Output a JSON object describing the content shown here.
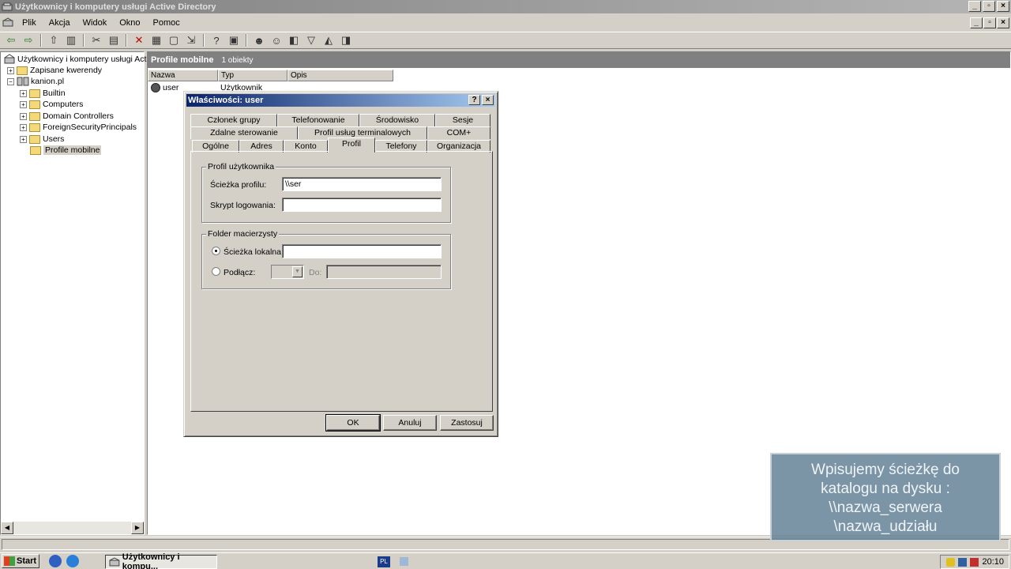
{
  "window": {
    "title": "Użytkownicy i komputery usługi Active Directory"
  },
  "menu": [
    "Plik",
    "Akcja",
    "Widok",
    "Okno",
    "Pomoc"
  ],
  "tree": {
    "root": "Użytkownicy i komputery usługi Activ",
    "saved": "Zapisane kwerendy",
    "domain": "kanion.pl",
    "children": [
      "Builtin",
      "Computers",
      "Domain Controllers",
      "ForeignSecurityPrincipals",
      "Users",
      "Profile mobilne"
    ]
  },
  "list": {
    "title": "Profile mobilne",
    "count": "1 obiekty",
    "columns": [
      "Nazwa",
      "Typ",
      "Opis"
    ],
    "rows": [
      {
        "name": "user",
        "type": "Użytkownik"
      }
    ]
  },
  "dialog": {
    "title": "Właściwości: user",
    "tabs_row1": [
      "Członek grupy",
      "Telefonowanie",
      "Środowisko",
      "Sesje"
    ],
    "tabs_row2": [
      "Zdalne sterowanie",
      "Profil usług terminalowych",
      "COM+"
    ],
    "tabs_row3": [
      "Ogólne",
      "Adres",
      "Konto",
      "Profil",
      "Telefony",
      "Organizacja"
    ],
    "profile_group": "Profil użytkownika",
    "profile_path_label": "Ścieżka profilu:",
    "profile_path_value": "\\\\ser",
    "logon_script_label": "Skrypt logowania:",
    "logon_script_value": "",
    "home_group": "Folder macierzysty",
    "local_path_label": "Ścieżka lokalna:",
    "local_path_value": "",
    "connect_label": "Podłącz:",
    "to_label": "Do:",
    "ok": "OK",
    "cancel": "Anuluj",
    "apply": "Zastosuj"
  },
  "taskbar": {
    "start": "Start",
    "task": "Użytkownicy i kompu...",
    "lang": "PL",
    "time": "20:10"
  },
  "caption": {
    "line1": "Wpisujemy ścieżkę do",
    "line2": "katalogu na dysku :",
    "line3": "\\\\nazwa_serwera",
    "line4": "\\nazwa_udziału"
  }
}
